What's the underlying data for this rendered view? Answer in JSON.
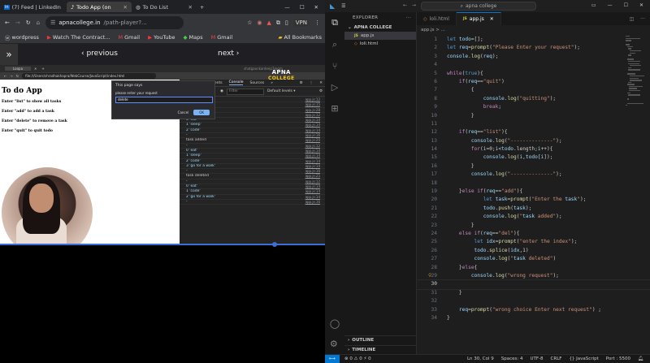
{
  "browser": {
    "tabs": [
      {
        "icon": "in",
        "label": "(7) Feed | LinkedIn"
      },
      {
        "icon": "♪",
        "label": "Todo App (on"
      },
      {
        "icon": "◍",
        "label": "To Do List"
      }
    ],
    "new_tab": "+",
    "url_host": "apnacollege.in",
    "url_path": "/path-player?...",
    "vpn": "VPN",
    "bookmarks": [
      "wordpress",
      "Watch The Contract...",
      "Gmail",
      "YouTube",
      "Maps",
      "Gmail"
    ],
    "all_bookmarks": "All Bookmarks",
    "nav_prev": "‹ previous",
    "nav_next": "next ›"
  },
  "inner_browser": {
    "tab_label": "Loopa",
    "url": "file:///Users/shradhakhapra/WebCourse/JavaScript/index.html",
    "page_title": "To do App",
    "instructions": [
      "Enter \"list\" to show all tasks",
      "Enter \"add\" to add a task",
      "Enter \"delete\" to remove a task",
      "Enter \"quit\" to quit todo"
    ],
    "dialog": {
      "title": "This page says",
      "message": "please enter your request",
      "value": "delete",
      "cancel": "Cancel",
      "ok": "OK"
    },
    "watermark_top": "APNA",
    "watermark_bottom": "COLLEGE",
    "watermark_email": "shatgaonkardeep7@gm",
    "devtools": {
      "tabs": [
        "nents",
        "Console",
        "Sources"
      ],
      "filter_placeholder": "Filter",
      "levels": "Default levels ▾",
      "logs": [
        {
          "msg": "-",
          "src": "app.js:12",
          "num": false
        },
        {
          "msg": "",
          "src": "app.js:15",
          "num": false
        },
        {
          "msg": "task added",
          "src": "app.js:28",
          "num": false
        },
        {
          "msg": "-",
          "src": "app.js:12",
          "num": false
        },
        {
          "msg": "0 'eat'",
          "src": "app.js:14",
          "num": true
        },
        {
          "msg": "1 'sleep'",
          "src": "app.js:14",
          "num": true
        },
        {
          "msg": "2 'code'",
          "src": "app.js:14",
          "num": true
        },
        {
          "msg": "-",
          "src": "app.js:16",
          "num": false
        },
        {
          "msg": "task added",
          "src": "app.js:20",
          "num": false
        },
        {
          "msg": "-",
          "src": "app.js:12",
          "num": false
        },
        {
          "msg": "0 'eat'",
          "src": "app.js:14",
          "num": true
        },
        {
          "msg": "1 'sleep'",
          "src": "app.js:14",
          "num": true
        },
        {
          "msg": "2 'code'",
          "src": "app.js:14",
          "num": true
        },
        {
          "msg": "3 'go for a walk'",
          "src": "app.js:14",
          "num": true
        },
        {
          "msg": "-",
          "src": "app.js:16",
          "num": false
        },
        {
          "msg": "task deleted",
          "src": "app.js:25",
          "num": false
        },
        {
          "msg": "-",
          "src": "app.js:12",
          "num": false
        },
        {
          "msg": "0 'eat'",
          "src": "app.js:14",
          "num": true
        },
        {
          "msg": "1 'code'",
          "src": "app.js:14",
          "num": true
        },
        {
          "msg": "2 'go for a walk'",
          "src": "app.js:14",
          "num": true
        },
        {
          "msg": "-",
          "src": "app.js:16",
          "num": false
        }
      ]
    }
  },
  "vscode": {
    "search": "apna college",
    "explorer_title": "EXPLORER",
    "folder": "APNA COLLEGE",
    "files": [
      {
        "name": "app.js",
        "type": "js",
        "selected": true
      },
      {
        "name": "loli.html",
        "type": "html",
        "selected": false
      }
    ],
    "outline": "OUTLINE",
    "timeline": "TIMELINE",
    "tabs": [
      {
        "name": "loli.html",
        "type": "html",
        "active": false
      },
      {
        "name": "app.js",
        "type": "js",
        "active": true
      }
    ],
    "breadcrumb": "app.js > ...",
    "code_lines": [
      "let todo=[];",
      "let req=prompt(\"Please Enter your request\");",
      "console.log(req);",
      "",
      "while(true){",
      "    if(req==\"quit\")",
      "        {",
      "            console.log(\"quitting\");",
      "            break;",
      "        }",
      "",
      "    if(req==\"list\"){",
      "        console.log(\"--------------\");",
      "        for(i=0;i<todo.length;i++){",
      "            console.log(i,todo[i]);",
      "        }",
      "        console.log(\"--------------\");",
      "",
      "    }else if(req==\"add\"){",
      "            let task=prompt(\"Enter the task\");",
      "            todo.push(task);",
      "            console.log(\"task added\");",
      "        }",
      "    else if(req==\"del\"){",
      "         let idx=prompt(\"enter the index\");",
      "         todo.splice(idx,1)",
      "         console.log(\"task deleted\")",
      "    }else{",
      "        console.log(\"wrong request\");",
      "",
      "    }",
      "",
      "    req=prompt(\"wrong choice Enter next request\") ;",
      "}"
    ],
    "line_numbers": [
      "1",
      "2",
      "3",
      "4",
      "5",
      "6",
      "7",
      "8",
      "9",
      "10",
      "11",
      "12",
      "13",
      "14",
      "15",
      "16",
      "17",
      "18",
      "19",
      "20",
      "21",
      "22",
      "23",
      "24",
      "25",
      "26",
      "27",
      "28",
      "29",
      "30",
      "31",
      "32",
      "33",
      "34"
    ],
    "status_left": "⊗ 0  ⚠ 0   ⚡ 0",
    "status_right": [
      "Ln 30, Col 9",
      "Spaces: 4",
      "UTF-8",
      "CRLF",
      "{} JavaScript",
      "Port : 5500"
    ],
    "colors": {
      "accent": "#0078d4",
      "bg": "#1e1e1e"
    }
  }
}
